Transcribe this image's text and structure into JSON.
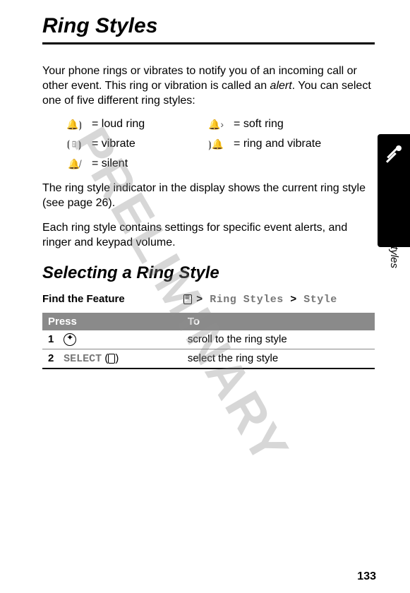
{
  "watermark": "PRELIMINARY",
  "title": "Ring Styles",
  "intro": "Your phone rings or vibrates to notify you of an incoming call or other event. This ring or vibration is called an ",
  "intro_em": "alert",
  "intro_tail": ". You can select one of five different ring styles:",
  "ring_modes": [
    {
      "label": "= loud ring"
    },
    {
      "label": "= soft ring"
    },
    {
      "label": "= vibrate"
    },
    {
      "label": "= ring and vibrate"
    },
    {
      "label": "= silent"
    }
  ],
  "para2": "The ring style indicator in the display shows the current ring style (see page 26).",
  "para3": "Each ring style contains settings for specific event alerts, and ringer and keypad volume.",
  "subheading": "Selecting a Ring Style",
  "feature_label": "Find the Feature",
  "feature_path": {
    "a": "Ring Styles",
    "b": "Style",
    "sep": ">"
  },
  "table": {
    "head_press": "Press",
    "head_to": "To",
    "rows": [
      {
        "num": "1",
        "key_icon": "nav",
        "key_text": "",
        "to": "scroll to the ring style"
      },
      {
        "num": "2",
        "key_icon": "soft",
        "key_text": "SELECT",
        "to": "select the ring style"
      }
    ]
  },
  "side_label": "Ring Styles",
  "page_number": "133"
}
